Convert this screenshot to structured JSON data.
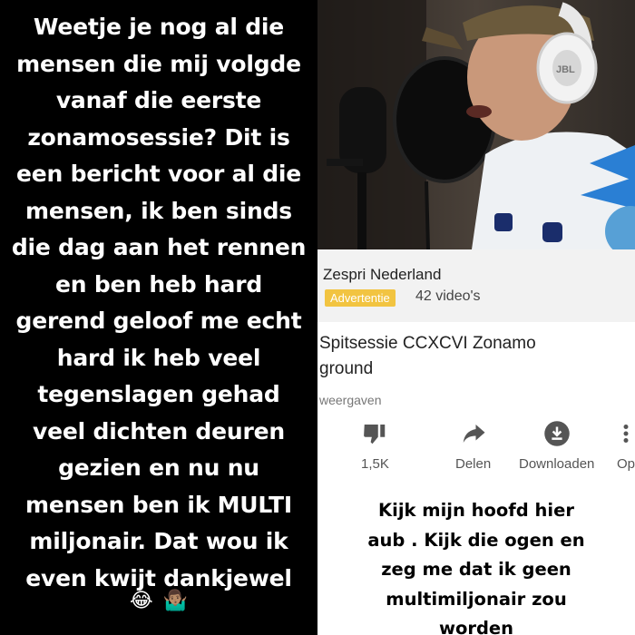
{
  "story": {
    "text": "Weetje je nog al die\nmensen die mij volgde\nvanaf die eerste\nzonamosessie? Dit is\neen bericht voor al die\nmensen, ik ben sinds\ndie dag aan het rennen\nen ben heb hard\ngerend geloof me echt\nhard ik heb veel\ntegenslagen gehad\nveel dichten deuren\ngezien en nu nu\nmensen ben ik MULTI\nmiljonair. Dat wou ik\neven kwijt dankjewel",
    "emoji_face": "😂",
    "emoji_shrug": "🤷🏽‍♂️"
  },
  "headphones": {
    "brand": "JBL"
  },
  "ad": {
    "channel_name": "Zespri Nederland",
    "badge": "Advertentie",
    "video_count": "42 video's"
  },
  "video": {
    "title": "Spitsessie CCXCVI Zonamo\nground",
    "views": "weergaven"
  },
  "actions": [
    {
      "label": "1,5K",
      "icon": "thumbs-down-icon"
    },
    {
      "label": "Delen",
      "icon": "share-icon"
    },
    {
      "label": "Downloaden",
      "icon": "download-icon"
    },
    {
      "label": "Op",
      "icon": "more-icon"
    }
  ],
  "caption": {
    "text": "Kijk mijn hoofd hier\naub . Kijk die ogen en\nzeg me dat ik geen\nmultimiljonair zou\nworden"
  },
  "colors": {
    "badge": "#f2c441",
    "background_left": "#000000",
    "text_left": "#ffffff"
  }
}
